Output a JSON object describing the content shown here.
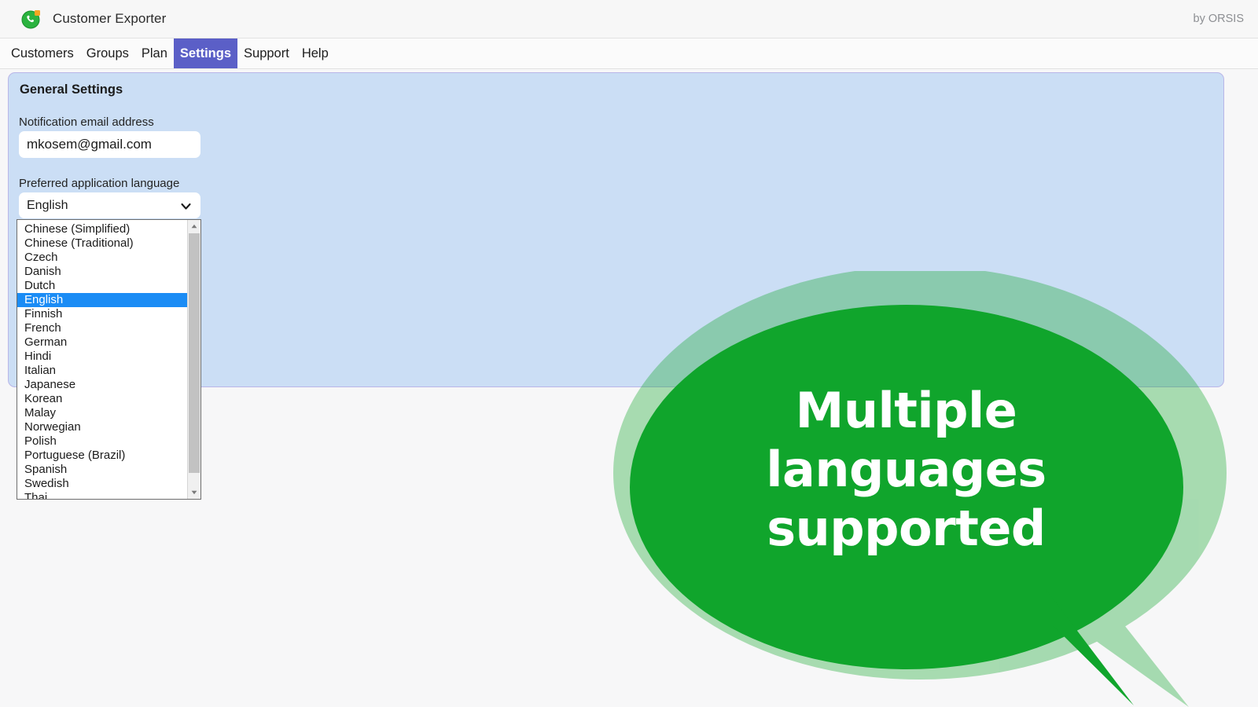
{
  "window": {
    "app_title": "Customer Exporter",
    "vendor": "by ORSIS",
    "app_icon": "whatsapp-green-phone-icon"
  },
  "colors": {
    "accent_nav_active": "#5b5fc7",
    "panel_fill": "#cbdef5",
    "panel_border": "#b9b6e8",
    "brand_green": "#10a52c",
    "dropdown_selected": "#1b8cf5",
    "page_background": "#f7f7f8"
  },
  "nav": {
    "items": [
      {
        "label": "Customers",
        "active": false
      },
      {
        "label": "Groups",
        "active": false
      },
      {
        "label": "Plan",
        "active": false
      },
      {
        "label": "Settings",
        "active": true
      },
      {
        "label": "Support",
        "active": false
      },
      {
        "label": "Help",
        "active": false
      }
    ]
  },
  "settings_panel": {
    "title": "General Settings",
    "email_field": {
      "label": "Notification email address",
      "value": "mkosem@gmail.com",
      "placeholder": "Notification email address"
    },
    "language_field": {
      "label": "Preferred application language",
      "selected": "English",
      "chevron_icon": "chevron-down-icon",
      "options": [
        "Chinese (Simplified)",
        "Chinese (Traditional)",
        "Czech",
        "Danish",
        "Dutch",
        "English",
        "Finnish",
        "French",
        "German",
        "Hindi",
        "Italian",
        "Japanese",
        "Korean",
        "Malay",
        "Norwegian",
        "Polish",
        "Portuguese (Brazil)",
        "Spanish",
        "Swedish",
        "Thai"
      ],
      "scrollbar": {
        "up_arrow_icon": "triangle-up-icon",
        "down_arrow_icon": "triangle-down-icon"
      }
    }
  },
  "callout": {
    "lines": [
      "Multiple",
      "languages",
      "supported"
    ],
    "shape": "speech-bubble"
  }
}
